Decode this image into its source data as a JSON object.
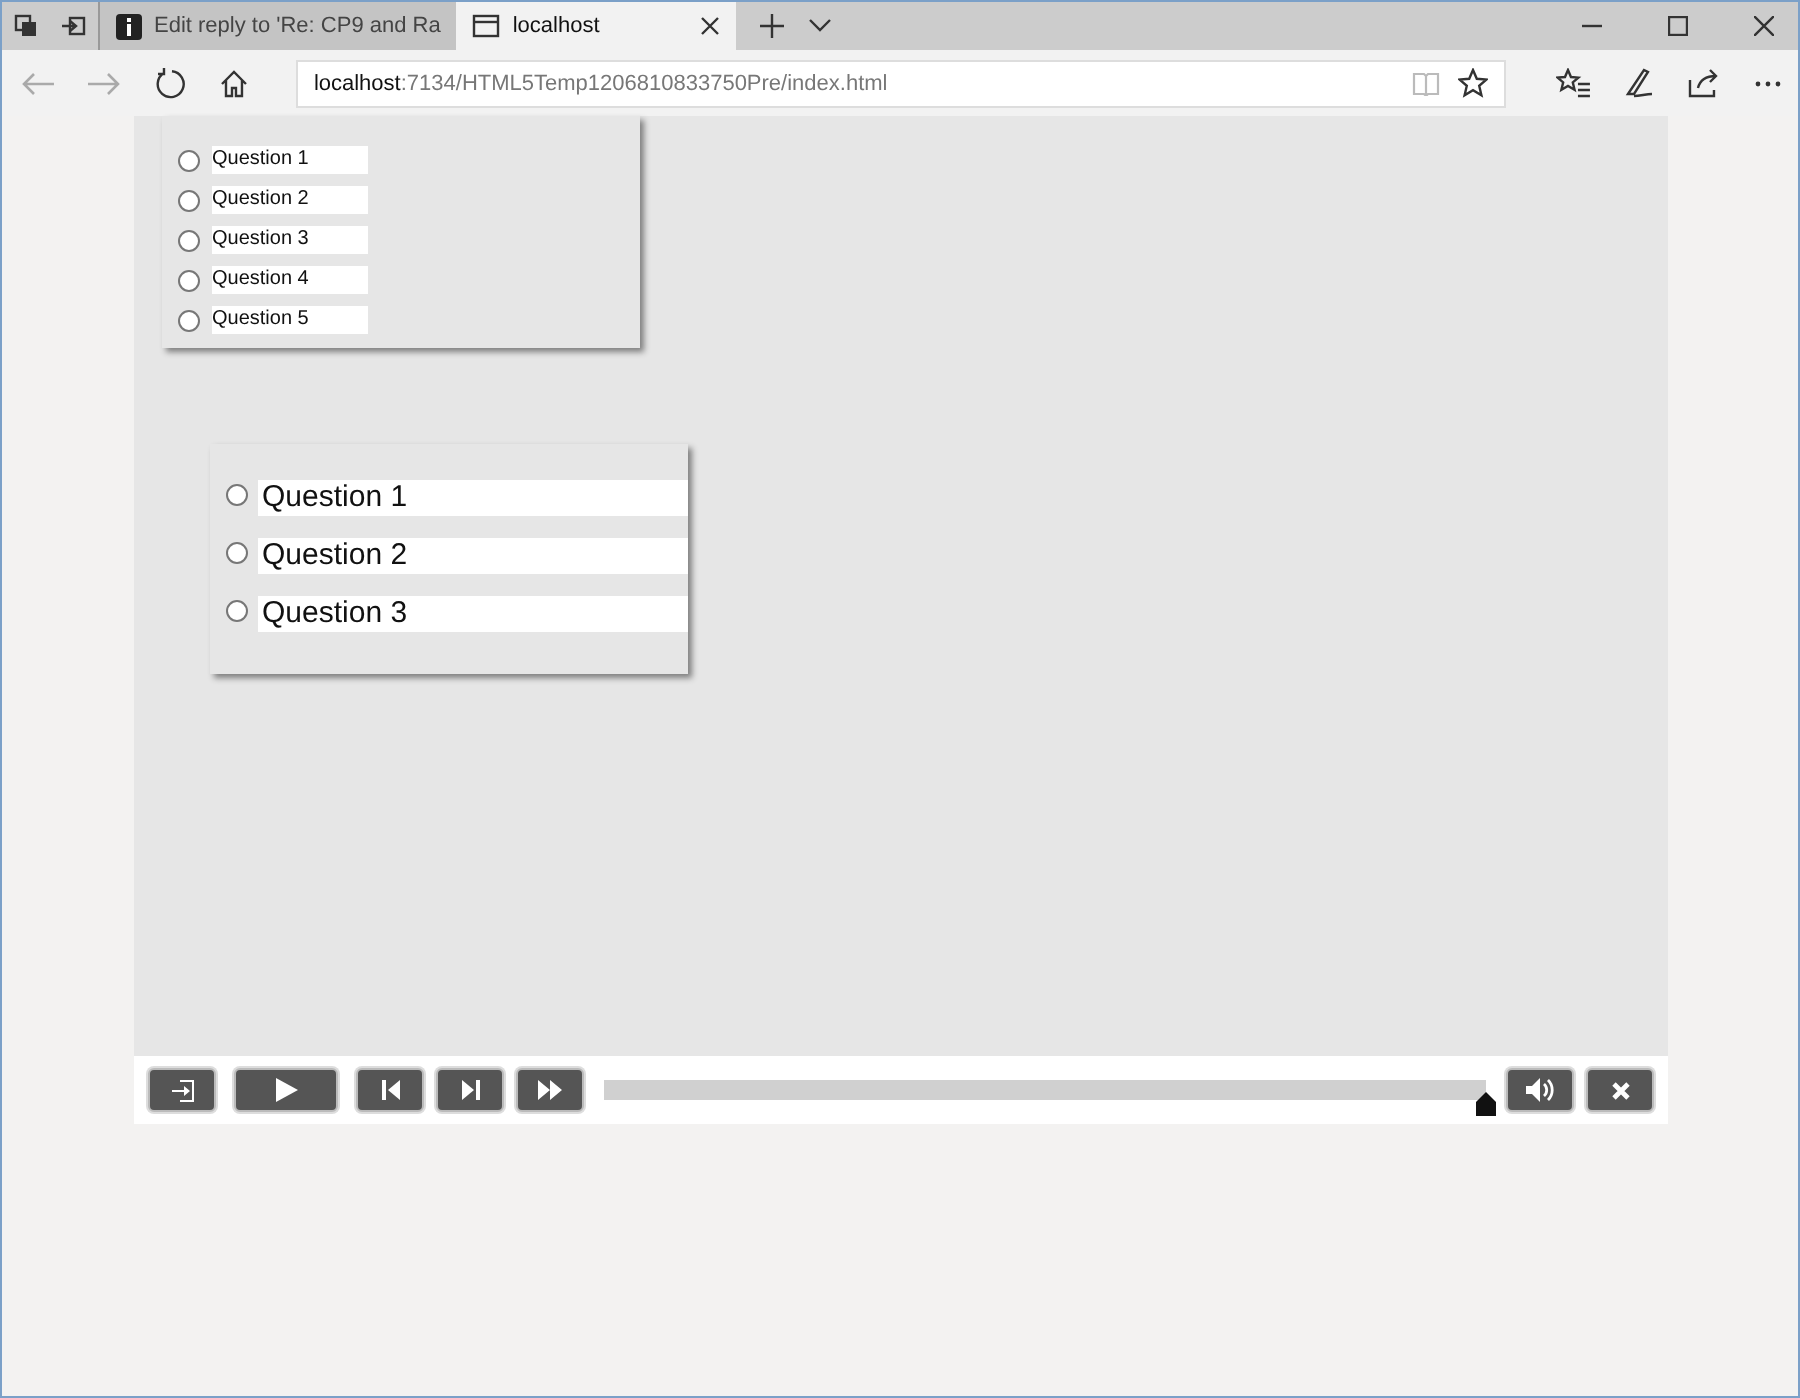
{
  "tabs": [
    {
      "label": "Edit reply to 'Re: CP9 and Ra",
      "selected": false
    },
    {
      "label": "localhost",
      "selected": true
    }
  ],
  "address": {
    "host": "localhost",
    "path": ":7134/HTML5Temp1206810833750Pre/index.html"
  },
  "quiz_small": {
    "questions": [
      {
        "label": "Question 1",
        "selected": false
      },
      {
        "label": "Question 2",
        "selected": false
      },
      {
        "label": "Question 3",
        "selected": false
      },
      {
        "label": "Question 4",
        "selected": false
      },
      {
        "label": "Question 5",
        "selected": false
      }
    ]
  },
  "quiz_large": {
    "questions": [
      {
        "label": "Question 1",
        "selected": false
      },
      {
        "label": "Question 2",
        "selected": false
      },
      {
        "label": "Question 3",
        "selected": false
      }
    ]
  },
  "player": {
    "progress": {
      "level": 1.0
    }
  }
}
